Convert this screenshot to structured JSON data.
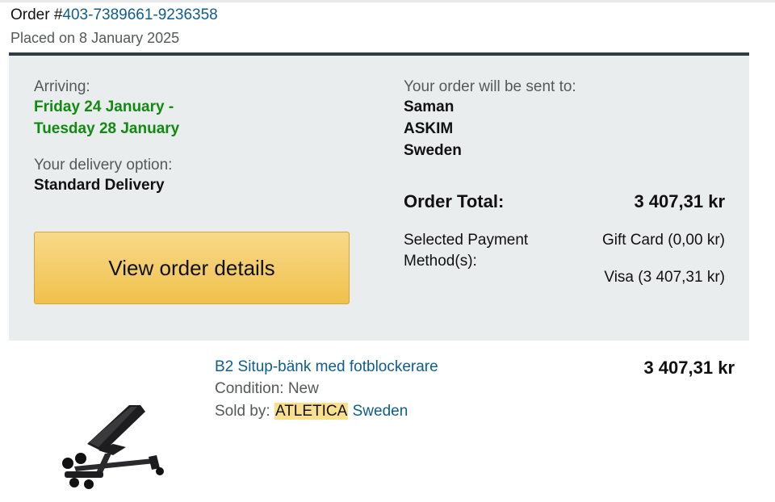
{
  "order": {
    "number_prefix": "Order #",
    "number": "403-7389661-9236358",
    "placed": "Placed on 8 January 2025"
  },
  "delivery": {
    "arriving_label": "Arriving:",
    "arriving_line1": "Friday 24 January -",
    "arriving_line2": "Tuesday 28 January",
    "option_label": "Your delivery option:",
    "option_value": "Standard Delivery"
  },
  "actions": {
    "view_details": "View order details"
  },
  "shipping": {
    "label": "Your order will be sent to:",
    "name": "Saman",
    "city": "ASKIM",
    "country": "Sweden"
  },
  "totals": {
    "label": "Order Total:",
    "value": "3 407,31 kr"
  },
  "payment": {
    "label_line1": "Selected Payment",
    "label_line2": "Method(s):",
    "methods": [
      "Gift Card (0,00 kr)",
      "Visa (3 407,31 kr)"
    ]
  },
  "item": {
    "title": "B2 Situp-bänk med fotblockerare",
    "condition": "Condition: New",
    "sold_by_prefix": "Sold by: ",
    "seller_highlight": "ATLETICA",
    "seller_rest": " Sweden",
    "price": "3 407,31 kr",
    "image_icon": "workout-bench-image"
  },
  "colors": {
    "link": "#0f5d8a",
    "arrival_green": "#118a12",
    "button_yellow": "#f0c14b",
    "summary_bg": "#eaeded",
    "highlight": "#fbe08c"
  }
}
